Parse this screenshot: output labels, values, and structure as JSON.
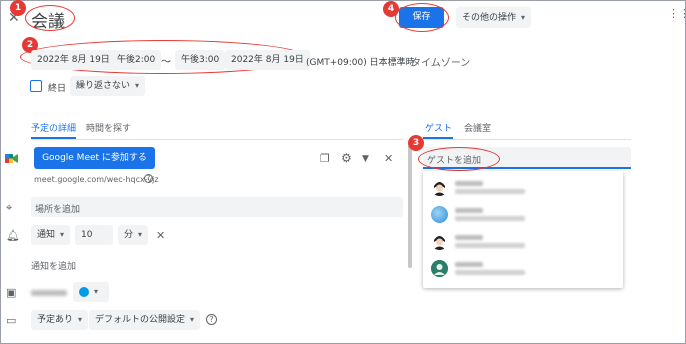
{
  "event": {
    "title": "会議",
    "start_date": "2022年 8月 19日",
    "start_time": "午後2:00",
    "separator": "〜",
    "end_time": "午後3:00",
    "end_date": "2022年 8月 19日",
    "timezone": "(GMT+09:00) 日本標準時",
    "timezone_link": "タイムゾーン",
    "all_day_label": "終日",
    "repeat": "繰り返さない"
  },
  "header": {
    "save_label": "保存",
    "more_actions": "その他の操作"
  },
  "tabs": {
    "details": "予定の詳細",
    "find_time": "時間を探す",
    "guests": "ゲスト",
    "rooms": "会議室"
  },
  "details": {
    "meet_button": "Google Meet に参加する",
    "meet_url": "meet.google.com/wec-hqcx-vjz",
    "location_placeholder": "場所を追加",
    "notification_type": "通知",
    "notification_value": "10",
    "notification_unit": "分",
    "add_notification": "通知を追加",
    "calendar_color": "#039be5",
    "availability": "予定あり",
    "visibility": "デフォルトの公開設定"
  },
  "guests": {
    "add_placeholder": "ゲストを追加"
  },
  "markers": [
    "1",
    "2",
    "3",
    "4"
  ],
  "colors": {
    "accent": "#1a73e8",
    "annotation": "#e53935"
  }
}
